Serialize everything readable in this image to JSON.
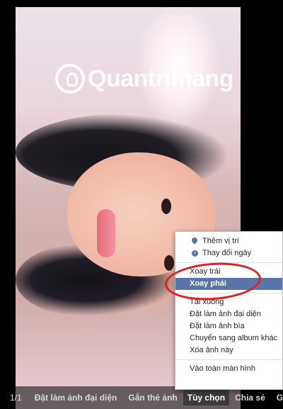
{
  "watermark": {
    "text": "Quantrimang"
  },
  "toolbar": {
    "counter": "1/1",
    "items": [
      {
        "label": "Đặt làm ảnh đại diện"
      },
      {
        "label": "Gắn thẻ ảnh"
      },
      {
        "label": "Tùy chọn"
      },
      {
        "label": "Chia sẻ"
      },
      {
        "label": "Gửi"
      }
    ]
  },
  "context_menu": {
    "items": [
      {
        "label": "Thêm vị trí",
        "icon": "location-pin-icon"
      },
      {
        "label": "Thay đổi ngày",
        "icon": "clock-icon"
      },
      {
        "label": "Xoay trái"
      },
      {
        "label": "Xoay phải"
      },
      {
        "label": "Tải xuống"
      },
      {
        "label": "Đặt làm ảnh đại diện"
      },
      {
        "label": "Đặt làm ảnh bìa"
      },
      {
        "label": "Chuyển sang album khác"
      },
      {
        "label": "Xóa ảnh này"
      },
      {
        "label": "Vào toàn màn hình"
      }
    ]
  },
  "colors": {
    "menu_highlight": "#5b75a8",
    "annotation": "#e01e1e"
  }
}
